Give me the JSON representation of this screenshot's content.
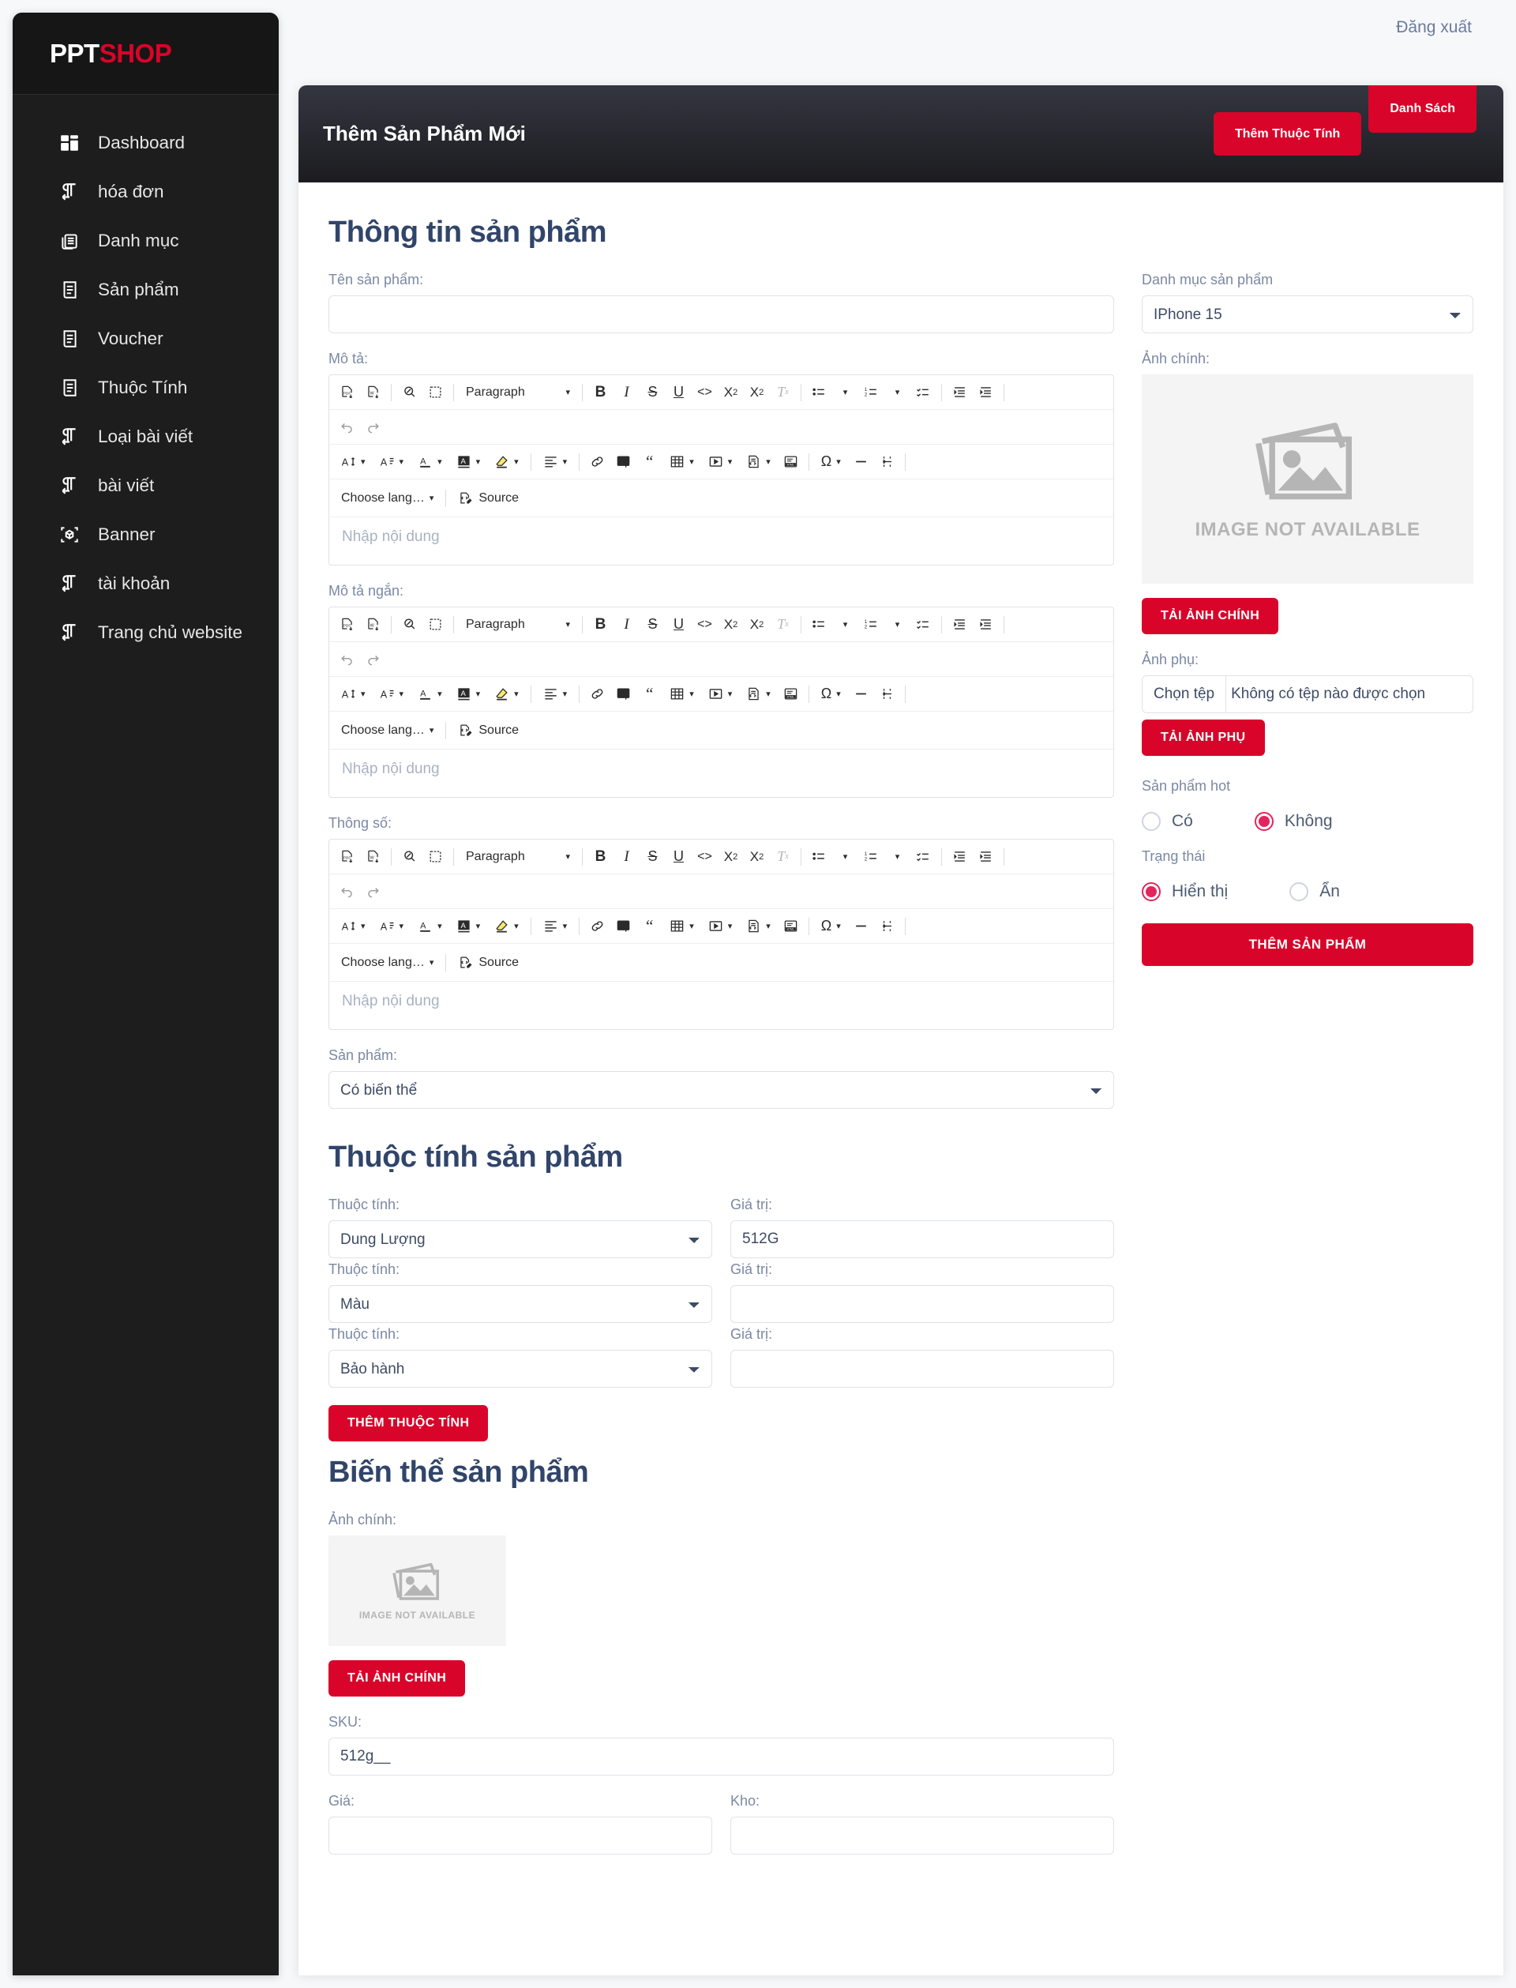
{
  "brand": {
    "part1": "PPT",
    "part2": "SHOP"
  },
  "topbar": {
    "logout": "Đăng xuất"
  },
  "sidebar": {
    "items": [
      {
        "label": "Dashboard",
        "icon": "dashboard-icon"
      },
      {
        "label": "hóa đơn",
        "icon": "invoice-icon"
      },
      {
        "label": "Danh mục",
        "icon": "category-icon"
      },
      {
        "label": "Sản phẩm",
        "icon": "product-icon"
      },
      {
        "label": "Voucher",
        "icon": "voucher-icon"
      },
      {
        "label": "Thuộc Tính",
        "icon": "attribute-icon"
      },
      {
        "label": "Loại bài viết",
        "icon": "post-type-icon"
      },
      {
        "label": "bài viết",
        "icon": "post-icon"
      },
      {
        "label": "Banner",
        "icon": "banner-icon"
      },
      {
        "label": "tài khoản",
        "icon": "account-icon"
      },
      {
        "label": "Trang chủ website",
        "icon": "home-icon"
      }
    ]
  },
  "header": {
    "title": "Thêm Sản Phẩm Mới",
    "btn_add_attribute": "Thêm Thuộc Tính",
    "btn_list": "Danh Sách"
  },
  "sections": {
    "product_info": "Thông tin sản phẩm",
    "product_attributes": "Thuộc tính sản phẩm",
    "product_variants": "Biến thể sản phẩm"
  },
  "form": {
    "product_name_label": "Tên sản phẩm:",
    "product_name_value": "",
    "description_label": "Mô tả:",
    "short_description_label": "Mô tả ngắn:",
    "specs_label": "Thông số:",
    "editor_placeholder": "Nhập nội dung",
    "product_type_label": "Sản phẩm:",
    "product_type_value": "Có biến thể",
    "category_label": "Danh mục sản phẩm",
    "category_value": "IPhone 15",
    "main_image_label": "Ảnh chính:",
    "image_placeholder_caption": "IMAGE NOT AVAILABLE",
    "btn_upload_main": "TẢI ẢNH CHÍNH",
    "sub_image_label": "Ảnh phụ:",
    "file_choose_label": "Chọn tệp",
    "file_none_label": "Không có tệp nào được chọn",
    "btn_upload_sub": "TẢI ẢNH PHỤ",
    "hot_label": "Sản phẩm hot",
    "hot_yes": "Có",
    "hot_no": "Không",
    "hot_selected": "no",
    "status_label": "Trạng thái",
    "status_show": "Hiển thị",
    "status_hide": "Ẩn",
    "status_selected": "show",
    "btn_submit": "THÊM SẢN PHẨM"
  },
  "attributes": {
    "attr_label": "Thuộc tính:",
    "value_label": "Giá trị:",
    "rows": [
      {
        "attr": "Dung Lượng",
        "value": "512G"
      },
      {
        "attr": "Màu",
        "value": ""
      },
      {
        "attr": "Bảo hành",
        "value": ""
      }
    ],
    "btn_add": "THÊM THUỘC TÍNH"
  },
  "variant": {
    "main_image_label": "Ảnh chính:",
    "image_placeholder_caption": "IMAGE NOT AVAILABLE",
    "btn_upload_main": "TẢI ẢNH CHÍNH",
    "sku_label": "SKU:",
    "sku_value": "512g__",
    "price_label": "Giá:",
    "price_value": "",
    "stock_label": "Kho:",
    "stock_value": ""
  },
  "editor": {
    "paragraph_label": "Paragraph",
    "choose_lang_label": "Choose lang…",
    "source_label": "Source",
    "buttons": [
      "export-pdf-icon",
      "export-word-icon",
      "find-replace-icon",
      "select-all-icon",
      "bold-icon",
      "italic-icon",
      "strikethrough-icon",
      "underline-icon",
      "code-icon",
      "subscript-icon",
      "superscript-icon",
      "remove-format-icon",
      "bulleted-list-icon",
      "numbered-list-icon",
      "todo-list-icon",
      "outdent-icon",
      "indent-icon",
      "undo-icon",
      "redo-icon",
      "font-size-icon",
      "font-family-icon",
      "font-color-icon",
      "font-background-icon",
      "highlight-icon",
      "alignment-icon",
      "link-icon",
      "image-upload-icon",
      "blockquote-icon",
      "table-icon",
      "media-icon",
      "template-icon",
      "html-embed-icon",
      "special-character-icon",
      "horizontal-line-icon",
      "page-break-icon"
    ]
  },
  "colors": {
    "accent_red": "#d90429",
    "radio_pink": "#e4245c",
    "heading_navy": "#31456a",
    "sidebar_bg": "#1d1d1d"
  }
}
